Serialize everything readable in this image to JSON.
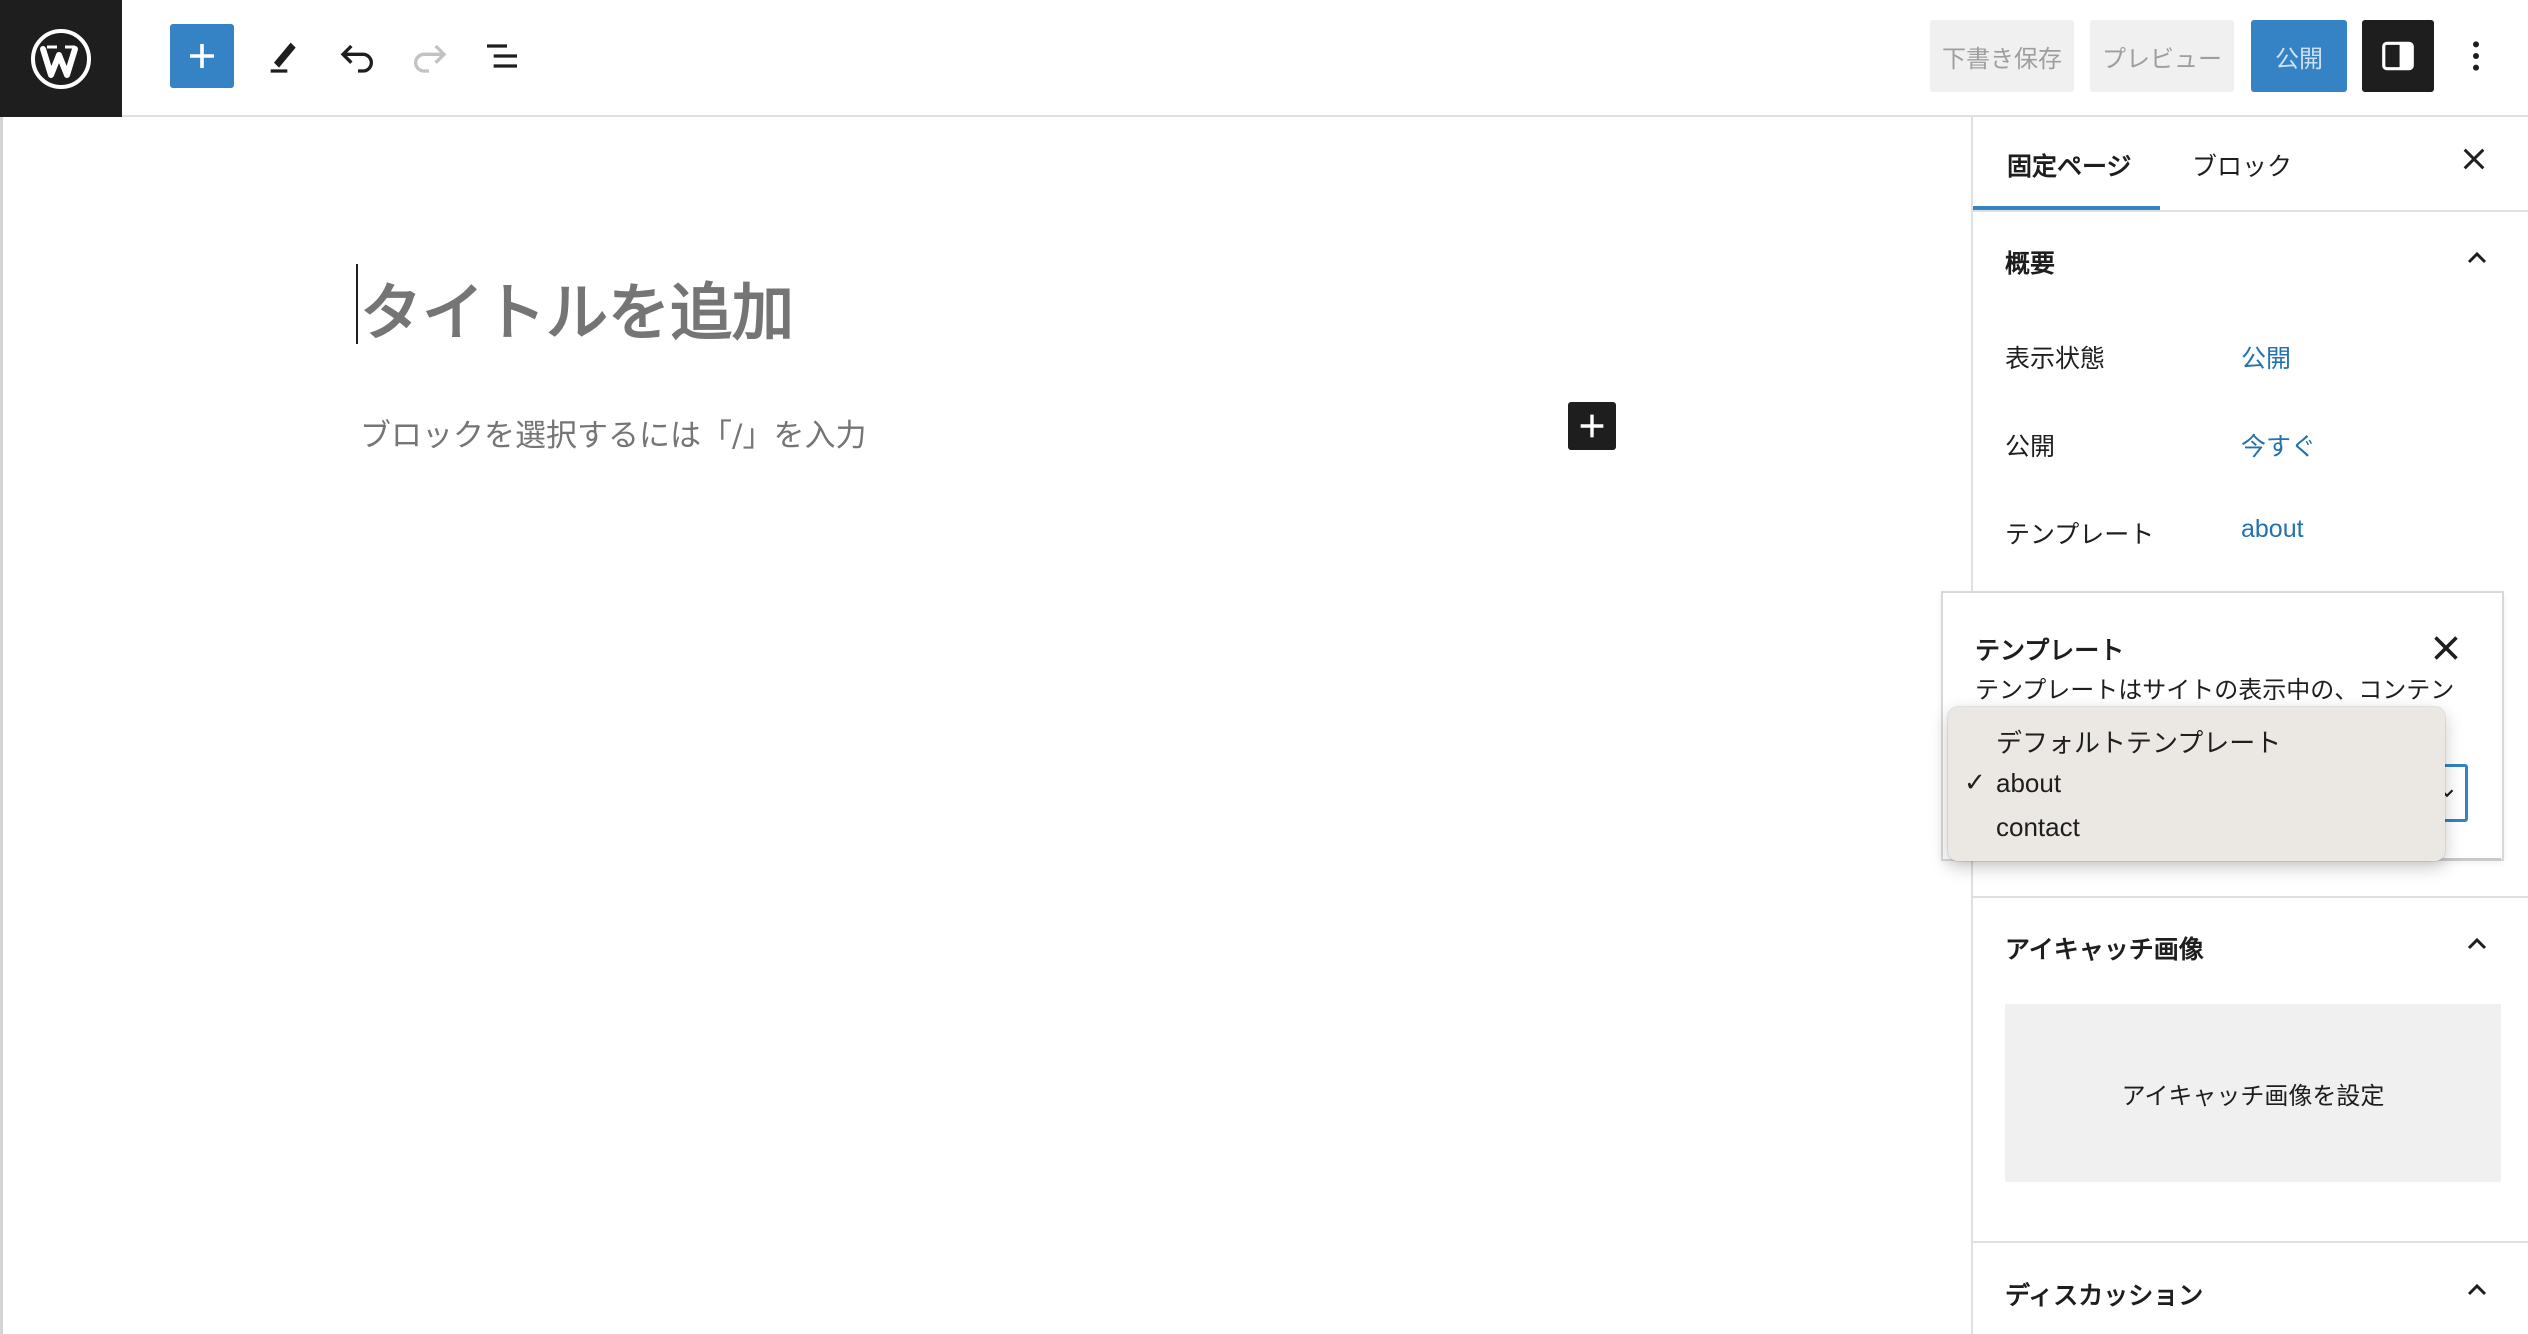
{
  "toolbar": {
    "draft_label": "下書き保存",
    "preview_label": "プレビュー",
    "publish_label": "公開"
  },
  "editor": {
    "title_placeholder": "タイトルを追加",
    "block_placeholder": "ブロックを選択するには「/」を入力"
  },
  "sidebar": {
    "tabs": [
      {
        "label": "固定ページ",
        "active": true
      },
      {
        "label": "ブロック",
        "active": false
      }
    ],
    "summary": {
      "heading": "概要",
      "rows": [
        {
          "label": "表示状態",
          "value": "公開"
        },
        {
          "label": "公開",
          "value": "今すぐ"
        },
        {
          "label": "テンプレート",
          "value": "about"
        }
      ]
    },
    "featured_image": {
      "heading": "アイキャッチ画像",
      "button_label": "アイキャッチ画像を設定"
    },
    "discussion": {
      "heading": "ディスカッション"
    }
  },
  "template_popover": {
    "title": "テンプレート",
    "description": "テンプレートはサイトの表示中の、コンテン",
    "options": [
      {
        "label": "デフォルトテンプレート",
        "selected": false
      },
      {
        "label": "about",
        "selected": true
      },
      {
        "label": "contact",
        "selected": false
      }
    ],
    "check_mark": "✓"
  },
  "colors": {
    "accent": "#3582c4",
    "link": "#2271b1",
    "dark": "#1e1e1e",
    "placeholder": "#757575"
  },
  "icons": [
    "wordpress-logo",
    "plus-icon",
    "pen-tool-icon",
    "undo-icon",
    "redo-icon",
    "list-view-icon",
    "sidebar-toggle-icon",
    "more-vertical-icon",
    "close-icon",
    "chevron-up-icon",
    "chevron-down-icon"
  ]
}
